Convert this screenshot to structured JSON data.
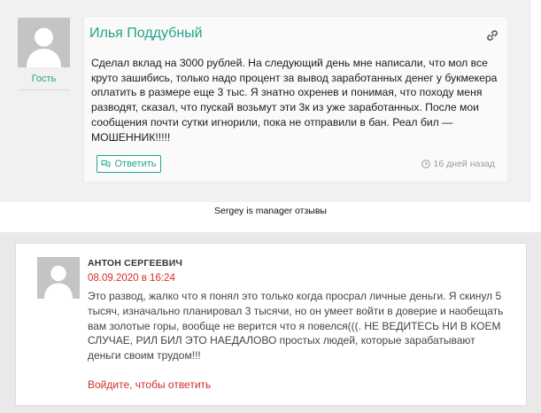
{
  "comment1": {
    "author": "Илья Поддубный",
    "role": "Гость",
    "text": "Сделал вклад на 3000 рублей. На следующий день мне написали, что мол все круто зашибись, только надо процент за вывод заработанных денег у букмекера оплатить в размере еще 3 тыс. Я знатно охренев и понимая, что походу меня разводят, сказал, что пускай возьмут эти 3к из уже заработанных. После мои сообщения почти сутки игнорили, пока не отправили в бан. Реал бил — МОШЕННИК!!!!!",
    "reply_label": "Ответить",
    "time_ago": "16 дней назад",
    "icons": {
      "link": "link-icon",
      "reply": "speech-bubbles-icon",
      "clock": "clock-icon",
      "avatar": "user-avatar-icon"
    }
  },
  "caption": "Sergey is manager отзывы",
  "comment2": {
    "author": "АНТОН СЕРГЕЕВИЧ",
    "date": "08.09.2020 в 16:24",
    "text": "Это развод, жалко что я понял это только когда просрал личные деньги. Я скинул 5 тысяч, изначально планировал 3 тысячи, но он умеет войти в доверие и наобещать вам золотые горы, вообще не верится что я повелся(((. НЕ ВЕДИТЕСЬ НИ В КОЕМ СЛУЧАЕ, РИЛ БИЛ ЭТО НАЕДАЛОВО простых людей, которые зарабатывают деньги своим трудом!!!",
    "login_to_reply": "Войдите, чтобы ответить"
  },
  "colors": {
    "accent_green": "#23a489",
    "accent_red": "#d0302f",
    "avatar_gray": "#c4c4c4"
  }
}
